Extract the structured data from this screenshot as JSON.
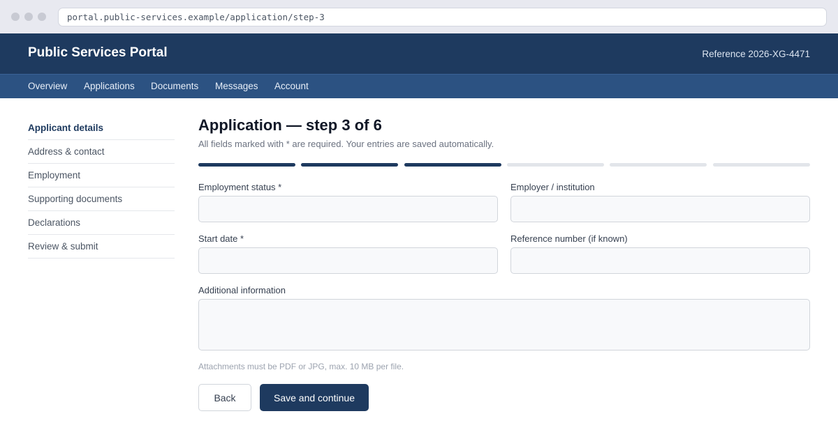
{
  "browser": {
    "url": "portal.public-services.example/application/step-3"
  },
  "header": {
    "title": "Public Services Portal",
    "reference": "Reference 2026-XG-4471"
  },
  "nav": {
    "items": [
      "Overview",
      "Applications",
      "Documents",
      "Messages",
      "Account"
    ]
  },
  "sidebar": {
    "items": [
      {
        "label": "Applicant details",
        "active": true
      },
      {
        "label": "Address & contact",
        "active": false
      },
      {
        "label": "Employment",
        "active": false
      },
      {
        "label": "Supporting documents",
        "active": false
      },
      {
        "label": "Declarations",
        "active": false
      },
      {
        "label": "Review & submit",
        "active": false
      }
    ]
  },
  "main": {
    "title": "Application — step 3 of 6",
    "subtitle": "All fields marked with * are required. Your entries are saved automatically.",
    "progress": {
      "completed_steps": 3,
      "total_steps": 6
    },
    "fields": {
      "employment_status": {
        "label": "Employment status *",
        "value": "",
        "placeholder": ""
      },
      "employer": {
        "label": "Employer / institution",
        "value": "",
        "placeholder": ""
      },
      "start_date": {
        "label": "Start date *",
        "value": "",
        "placeholder": ""
      },
      "reference_number": {
        "label": "Reference number (if known)",
        "value": "",
        "placeholder": ""
      },
      "additional_info": {
        "label": "Additional information",
        "value": "",
        "placeholder": ""
      }
    },
    "hint": "Attachments must be PDF or JPG, max. 10 MB per file.",
    "buttons": {
      "back": "Back",
      "save": "Save and continue"
    }
  },
  "colors": {
    "header_bg": "#1e3a5f",
    "nav_bg": "#2c5282",
    "primary": "#1e3a5f",
    "progress_inactive": "#e2e5ea"
  }
}
